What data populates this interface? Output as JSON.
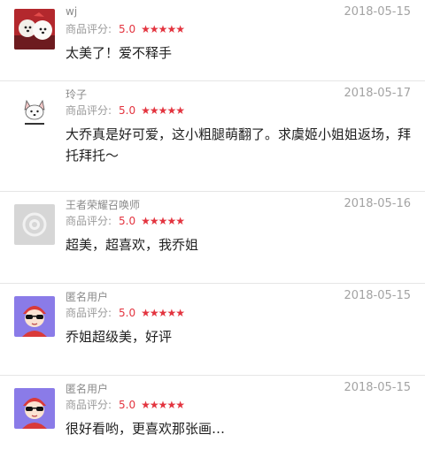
{
  "colors": {
    "accent": "#e3343f"
  },
  "reviews": [
    {
      "username": "wj",
      "date": "2018-05-15",
      "rating_label": "商品评分:",
      "score": "5.0",
      "stars": 5,
      "content": "太美了！爱不释手",
      "avatar_icon": "dog-photo-avatar"
    },
    {
      "username": "玲子",
      "date": "2018-05-17",
      "rating_label": "商品评分:",
      "score": "5.0",
      "stars": 5,
      "content": "大乔真是好可爱，这小粗腿萌翻了。求虞姬小姐姐返场，拜托拜托～",
      "avatar_icon": "cartoon-dog-avatar"
    },
    {
      "username": "王者荣耀召唤师",
      "date": "2018-05-16",
      "rating_label": "商品评分:",
      "score": "5.0",
      "stars": 5,
      "content": "超美，超喜欢，我乔姐",
      "avatar_icon": "default-gray-avatar"
    },
    {
      "username": "匿名用户",
      "date": "2018-05-15",
      "rating_label": "商品评分:",
      "score": "5.0",
      "stars": 5,
      "content": "乔姐超级美，好评",
      "avatar_icon": "anonymous-sunglasses-avatar"
    },
    {
      "username": "匿名用户",
      "date": "2018-05-15",
      "rating_label": "商品评分:",
      "score": "5.0",
      "stars": 5,
      "content": "很好看哟，更喜欢那张画…",
      "avatar_icon": "anonymous-sunglasses-avatar"
    }
  ]
}
